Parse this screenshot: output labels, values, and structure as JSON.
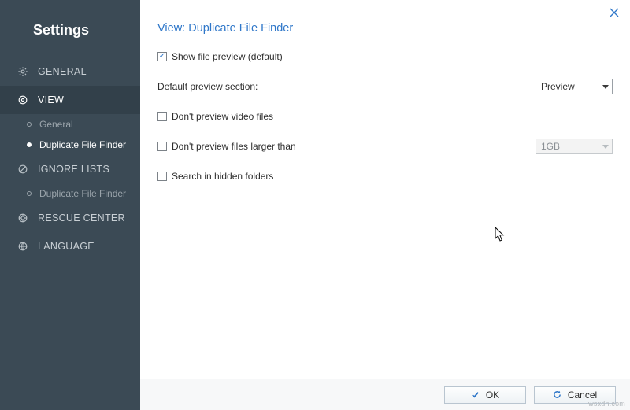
{
  "sidebar": {
    "title": "Settings",
    "items": [
      {
        "label": "GENERAL"
      },
      {
        "label": "VIEW",
        "children": [
          {
            "label": "General"
          },
          {
            "label": "Duplicate File Finder"
          }
        ]
      },
      {
        "label": "IGNORE LISTS",
        "children": [
          {
            "label": "Duplicate File Finder"
          }
        ]
      },
      {
        "label": "RESCUE CENTER"
      },
      {
        "label": "LANGUAGE"
      }
    ]
  },
  "main": {
    "heading": "View: Duplicate File Finder",
    "options": {
      "show_preview": "Show file preview (default)",
      "default_section": "Default preview section:",
      "default_section_value": "Preview",
      "no_video": "Don't preview video files",
      "no_large": "Don't preview files larger than",
      "no_large_value": "1GB",
      "search_hidden": "Search in hidden folders"
    }
  },
  "footer": {
    "ok": "OK",
    "cancel": "Cancel"
  },
  "watermark": "wsxdn.com"
}
